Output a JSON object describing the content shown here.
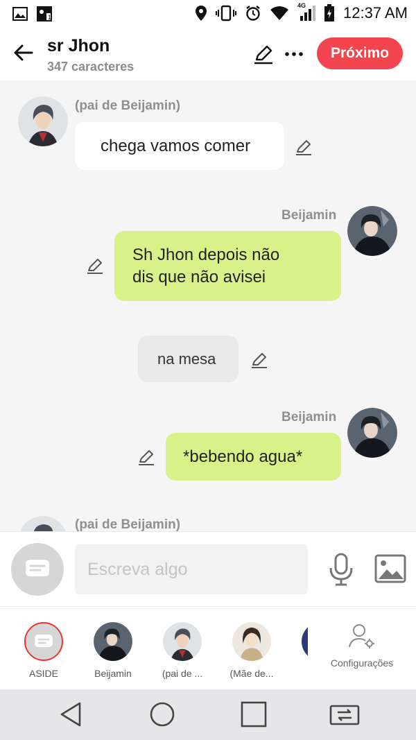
{
  "status_bar": {
    "time": "12:37 AM",
    "network": "4G"
  },
  "header": {
    "title": "sr Jhon",
    "subtitle": "347 caracteres",
    "next_label": "Próximo"
  },
  "messages": [
    {
      "speaker": "(pai de Beijamin)",
      "text": "chega vamos comer",
      "side": "left"
    },
    {
      "speaker": "Beijamin",
      "text_line1": "Sh Jhon depois não",
      "text_line2": "dis que não avisei",
      "side": "right"
    },
    {
      "speaker": "",
      "text": "na mesa",
      "side": "center"
    },
    {
      "speaker": "Beijamin",
      "text": "*bebendo agua*",
      "side": "right"
    },
    {
      "speaker": "(pai de Beijamin)",
      "side": "left"
    }
  ],
  "input": {
    "placeholder": "Escreva algo"
  },
  "characters": [
    {
      "label": "ASIDE"
    },
    {
      "label": "Beijamin"
    },
    {
      "label": "(pai de ..."
    },
    {
      "label": "(Mãe de..."
    }
  ],
  "settings_label": "Configurações",
  "colors": {
    "accent": "#f2454f",
    "green_bubble": "#d8f28a",
    "white_bubble": "#ffffff",
    "aside_bubble": "#e9e9e9"
  },
  "icons": [
    "back-arrow-icon",
    "pencil-icon",
    "more-icon",
    "microphone-icon",
    "image-icon",
    "settings-icon",
    "nav-back-icon",
    "nav-home-icon",
    "nav-recents-icon",
    "nav-switch-icon"
  ]
}
